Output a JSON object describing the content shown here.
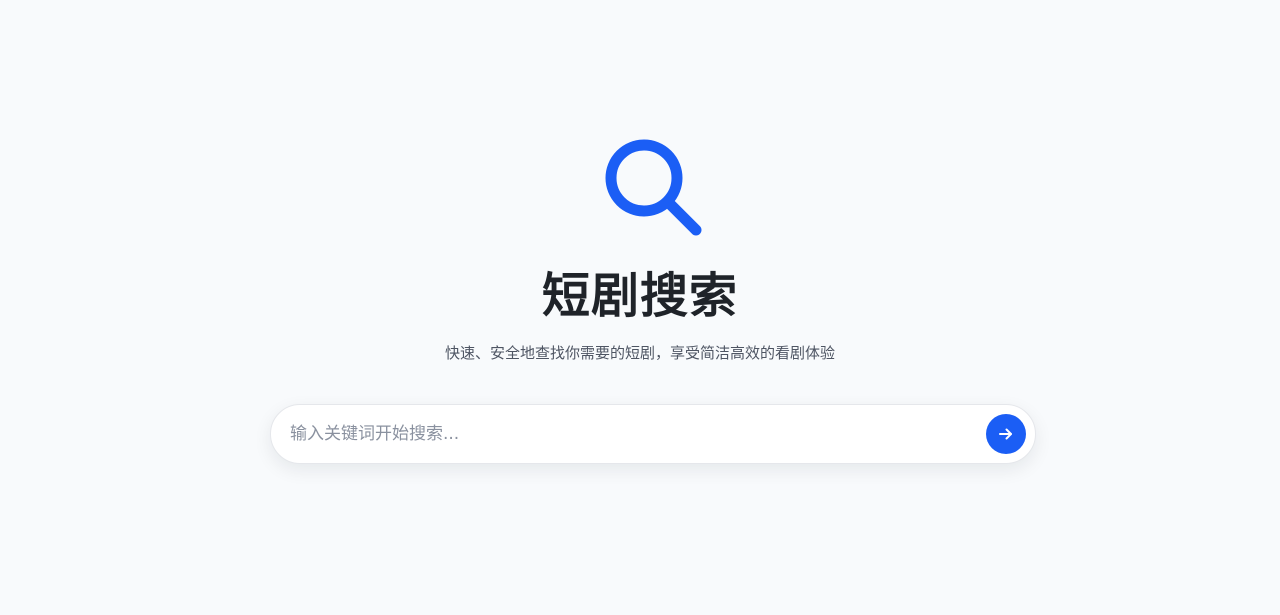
{
  "hero": {
    "icon": "search-icon",
    "title": "短剧搜索",
    "subtitle": "快速、安全地查找你需要的短剧，享受简洁高效的看剧体验"
  },
  "search": {
    "placeholder": "输入关键词开始搜索...",
    "value": "",
    "submit_icon": "arrow-right-icon"
  },
  "colors": {
    "accent": "#1b5ef5",
    "background": "#f8fafc",
    "title": "#1f2329",
    "subtitle": "#4e5563"
  }
}
